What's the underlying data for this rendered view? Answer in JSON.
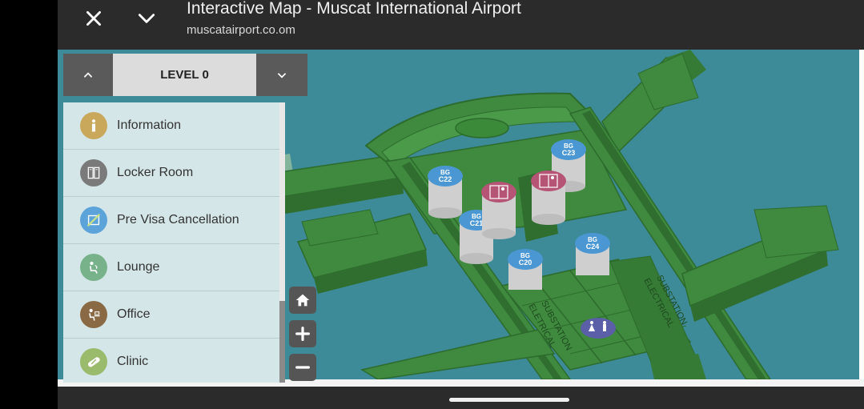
{
  "header": {
    "title": "Interactive Map - Muscat International Airport",
    "url": "muscatairport.co.om",
    "close_icon": "close-icon",
    "collapse_icon": "chevron-down-icon"
  },
  "level_selector": {
    "label": "LEVEL 0"
  },
  "poi_list": {
    "items": [
      {
        "label": "Information",
        "icon": "info-icon",
        "color": "#c9a85c"
      },
      {
        "label": "Locker Room",
        "icon": "locker-icon",
        "color": "#7a7a7a"
      },
      {
        "label": "Pre Visa Cancellation",
        "icon": "visa-icon",
        "color": "#5ba3d9"
      },
      {
        "label": "Lounge",
        "icon": "lounge-icon",
        "color": "#77b28a"
      },
      {
        "label": "Office",
        "icon": "office-icon",
        "color": "#8a6a44"
      },
      {
        "label": "Clinic",
        "icon": "clinic-icon",
        "color": "#9aba6c"
      }
    ]
  },
  "map": {
    "gates": [
      {
        "top": "BG",
        "bottom": "C22"
      },
      {
        "top": "BG",
        "bottom": "C23"
      },
      {
        "top": "BG",
        "bottom": "C21"
      },
      {
        "top": "BG",
        "bottom": "C20"
      },
      {
        "top": "BG",
        "bottom": "C24"
      }
    ],
    "labels": {
      "substation_left_1": "ELETRICAL",
      "substation_left_2": "SUBSTATION",
      "substation_right_1": "ELECTRICAL",
      "substation_right_2": "SUBSTATION"
    },
    "colors": {
      "water": "#3d8b98",
      "building": "#3f8a3f",
      "gate_marker": "#4a97d4",
      "elevator_marker": "#b55475",
      "restroom_marker": "#5a5fa8"
    }
  }
}
